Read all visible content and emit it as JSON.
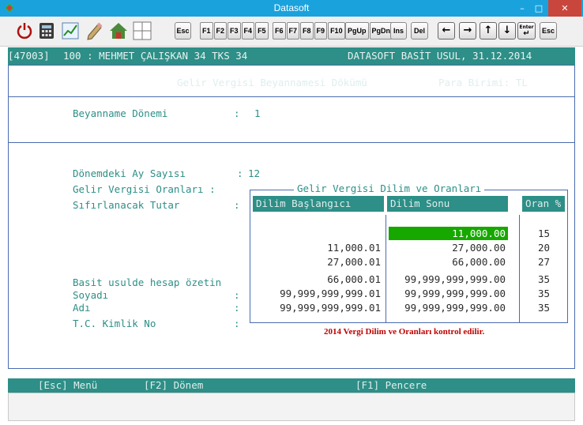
{
  "window": {
    "title": "Datasoft",
    "min": "–",
    "max": "□",
    "close": "✕"
  },
  "toolbar": {
    "icons": [
      "power-icon",
      "calculator-icon",
      "chart-icon",
      "pencil-icon",
      "house-icon",
      "grid-icon"
    ],
    "keys": {
      "esc": "Esc",
      "f1": "F1",
      "f2": "F2",
      "f3": "F3",
      "f4": "F4",
      "f5": "F5",
      "f6": "F6",
      "f7": "F7",
      "f8": "F8",
      "f9": "F9",
      "f10": "F10",
      "pgup": "PgUp",
      "pgdn": "PgDn",
      "ins": "Ins",
      "del": "Del",
      "enter": "Enter",
      "esc2": "Esc"
    },
    "arrows": {
      "left": "←",
      "right": "→",
      "up": "↑",
      "down": "↓",
      "enter": "↵"
    }
  },
  "header": {
    "code": "[47003]",
    "firm": "100 : MEHMET ÇALIŞKAN 34 TKS 34",
    "info": "DATASOFT BASİT USUL, 31.12.2014"
  },
  "form": {
    "title": "Gelir Vergisi Beyannamesi Dökümü",
    "currency": "Para Birimi: TL",
    "period_label": "Beyanname Dönemi",
    "period_sep": ":",
    "period_value": "1",
    "months_label": "Dönemdeki Ay Sayısı",
    "months_sep": ":",
    "months_value": "12",
    "rates_label": "Gelir Vergisi Oranları :",
    "reset_label": "Sıfırlanacak Tutar",
    "reset_sep": ":",
    "summary_label": "Basit usulde hesap özetin",
    "surname_label": "Soyadı",
    "surname_sep": ":",
    "name_label": "Adı",
    "name_sep": ":",
    "tc_label": "T.C. Kimlik No",
    "tc_sep": ":"
  },
  "dilim": {
    "title": "Gelir Vergisi Dilim ve Oranları",
    "headers": {
      "start": "Dilim Başlangıcı",
      "end": "Dilim Sonu",
      "rate": "Oran %"
    },
    "rows": [
      {
        "start": "",
        "end": "11,000.00",
        "rate": "15"
      },
      {
        "start": "11,000.01",
        "end": "27,000.00",
        "rate": "20"
      },
      {
        "start": "27,000.01",
        "end": "66,000.00",
        "rate": "27"
      },
      {
        "start": "66,000.01",
        "end": "99,999,999,999.00",
        "rate": "35"
      },
      {
        "start": "99,999,999,999.01",
        "end": "99,999,999,999.00",
        "rate": "35"
      },
      {
        "start": "99,999,999,999.01",
        "end": "99,999,999,999.00",
        "rate": "35"
      }
    ],
    "note": "2014 Vergi Dilim ve Oranları kontrol edilir."
  },
  "status": {
    "esc": "[Esc] Menü",
    "f2": "[F2] Dönem",
    "f1": "[F1] Pencere"
  },
  "colors": {
    "teal": "#2d8f87",
    "titlebar": "#1aa2dd",
    "highlight": "#17a800",
    "note": "#c00000"
  }
}
